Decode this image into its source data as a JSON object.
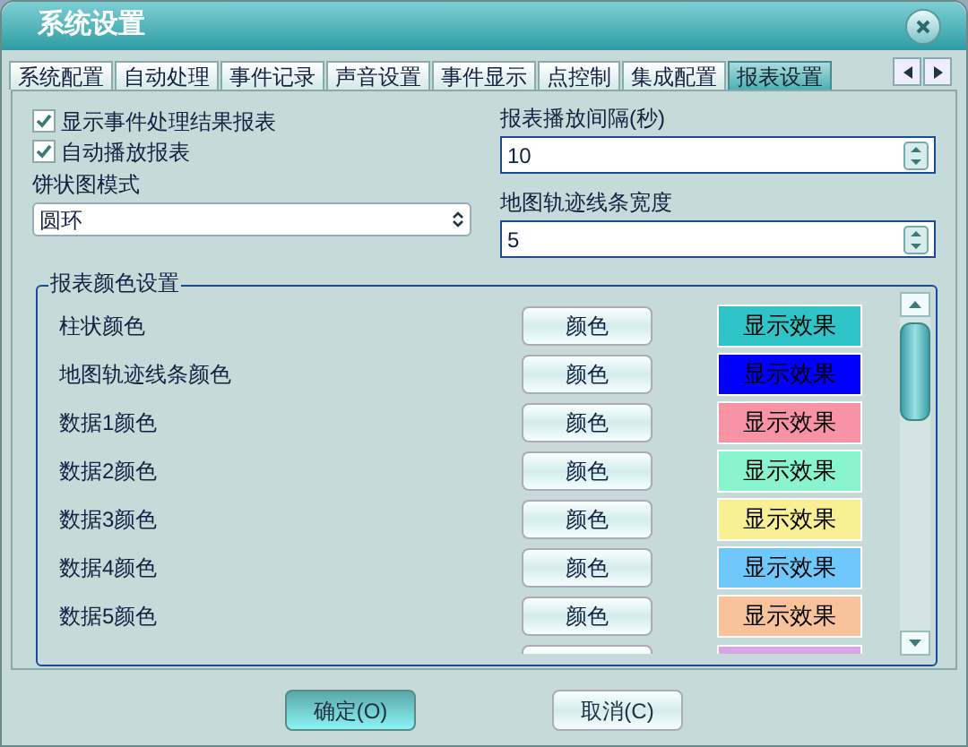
{
  "window": {
    "title": "系统设置"
  },
  "tabs": [
    {
      "label": "系统配置",
      "selected": false
    },
    {
      "label": "自动处理",
      "selected": false
    },
    {
      "label": "事件记录",
      "selected": false
    },
    {
      "label": "声音设置",
      "selected": false
    },
    {
      "label": "事件显示",
      "selected": false
    },
    {
      "label": "点控制",
      "selected": false
    },
    {
      "label": "集成配置",
      "selected": false
    },
    {
      "label": "报表设置",
      "selected": true
    }
  ],
  "checkboxes": [
    {
      "label": "显示事件处理结果报表",
      "checked": true
    },
    {
      "label": "自动播放报表",
      "checked": true
    }
  ],
  "pie_mode": {
    "label": "饼状图模式",
    "value": "圆环"
  },
  "play_interval": {
    "label": "报表播放间隔(秒)",
    "value": "10"
  },
  "track_width": {
    "label": "地图轨迹线条宽度",
    "value": "5"
  },
  "color_group": {
    "title": "报表颜色设置",
    "rows": [
      {
        "label": "柱状颜色",
        "button": "颜色",
        "preview": "显示效果",
        "color": "#2fc4c8"
      },
      {
        "label": "地图轨迹线条颜色",
        "button": "颜色",
        "preview": "显示效果",
        "color": "#0000ff"
      },
      {
        "label": "数据1颜色",
        "button": "颜色",
        "preview": "显示效果",
        "color": "#f893a5"
      },
      {
        "label": "数据2颜色",
        "button": "颜色",
        "preview": "显示效果",
        "color": "#88f5cf"
      },
      {
        "label": "数据3颜色",
        "button": "颜色",
        "preview": "显示效果",
        "color": "#f8f093"
      },
      {
        "label": "数据4颜色",
        "button": "颜色",
        "preview": "显示效果",
        "color": "#6fc8fb"
      },
      {
        "label": "数据5颜色",
        "button": "颜色",
        "preview": "显示效果",
        "color": "#f8c39a"
      }
    ],
    "partial_row": {
      "color": "#d8a4e8"
    }
  },
  "buttons": [
    {
      "label": "确定(O)",
      "selected": true
    },
    {
      "label": "取消(C)",
      "selected": false
    }
  ]
}
